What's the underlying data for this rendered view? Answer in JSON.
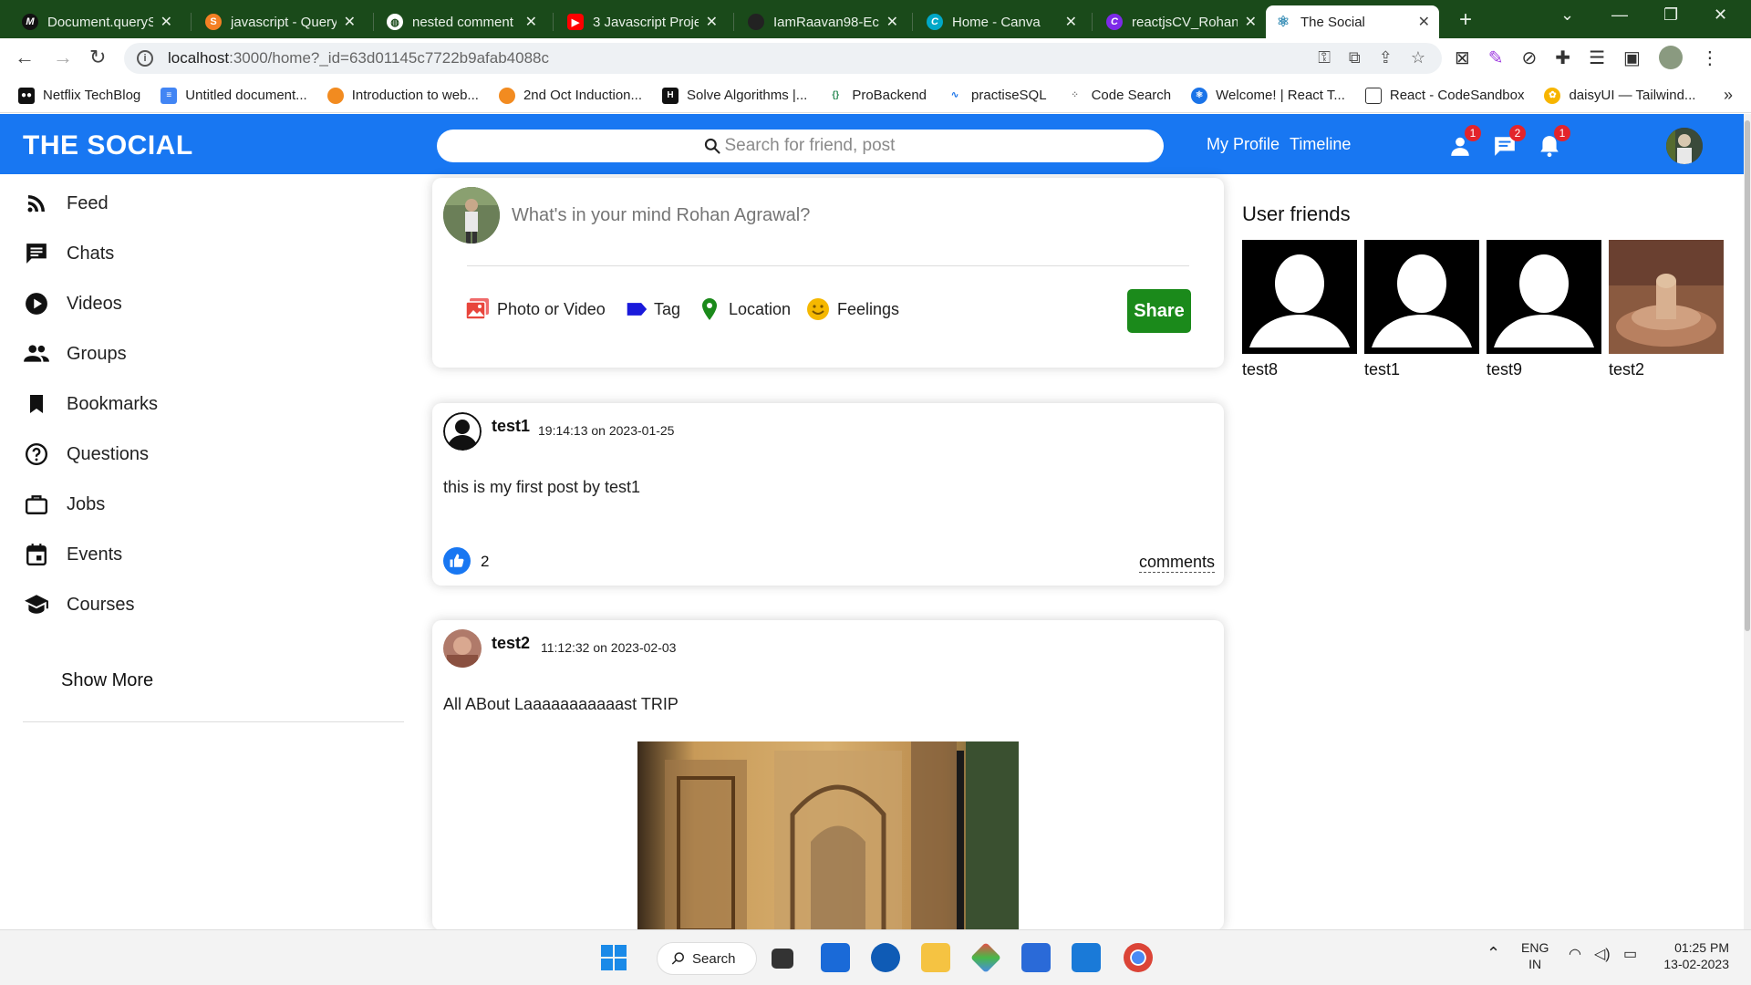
{
  "browser": {
    "tabs": [
      {
        "title": "Document.queryS",
        "icon": "m-icon",
        "color": "#ffffff"
      },
      {
        "title": "javascript - Query",
        "icon": "stackoverflow-icon",
        "color": "#f48024"
      },
      {
        "title": "nested comment",
        "icon": "globe-icon",
        "color": "#ffffff"
      },
      {
        "title": "3 Javascript Proje",
        "icon": "youtube-icon",
        "color": "#ff0000"
      },
      {
        "title": "IamRaavan98-Eco",
        "icon": "github-icon",
        "color": "#333333"
      },
      {
        "title": "Home - Canva",
        "icon": "canva-icon",
        "color": "#00c4cc"
      },
      {
        "title": "reactjsCV_Rohan",
        "icon": "canva-icon",
        "color": "#7d2ae8"
      },
      {
        "title": "The Social",
        "icon": "react-icon",
        "color": "#61dafb"
      }
    ],
    "new_tab": "+",
    "url_host": "localhost",
    "url_rest": ":3000/home?_id=63d01145c7722b9afab4088c",
    "bookmarks": [
      {
        "label": "Netflix TechBlog",
        "color": "#000000",
        "glyph": "M"
      },
      {
        "label": "Untitled document...",
        "color": "#4285f4",
        "glyph": "≡"
      },
      {
        "label": "Introduction to web...",
        "color": "#f28b20",
        "glyph": ""
      },
      {
        "label": "2nd Oct Induction...",
        "color": "#f28b20",
        "glyph": ""
      },
      {
        "label": "Solve Algorithms |...",
        "color": "#000000",
        "glyph": "H"
      },
      {
        "label": "ProBackend",
        "color": "#2e8b57",
        "glyph": "{}"
      },
      {
        "label": "practiseSQL",
        "color": "#1a73e8",
        "glyph": "~"
      },
      {
        "label": "Code Search",
        "color": "#777777",
        "glyph": "⁘"
      },
      {
        "label": "Welcome! | React T...",
        "color": "#1a73e8",
        "glyph": "⚛"
      },
      {
        "label": "React - CodeSandbox",
        "color": "#ffffff",
        "glyph": ""
      },
      {
        "label": "daisyUI — Tailwind...",
        "color": "#f7b500",
        "glyph": "✿"
      }
    ],
    "bookmarks_more": "»"
  },
  "app": {
    "logo": "THE SOCIAL",
    "search_placeholder": "Search for friend, post or video",
    "links": {
      "profile": "My Profile",
      "timeline": "Timeline"
    },
    "badges": {
      "friends": "1",
      "chat": "2",
      "notifications": "1"
    },
    "accent": "#1877f2"
  },
  "sidebar": {
    "items": [
      {
        "label": "Feed",
        "icon": "rss-icon"
      },
      {
        "label": "Chats",
        "icon": "chat-icon"
      },
      {
        "label": "Videos",
        "icon": "play-circle-icon"
      },
      {
        "label": "Groups",
        "icon": "group-icon"
      },
      {
        "label": "Bookmarks",
        "icon": "bookmark-icon"
      },
      {
        "label": "Questions",
        "icon": "help-circle-icon"
      },
      {
        "label": "Jobs",
        "icon": "briefcase-icon"
      },
      {
        "label": "Events",
        "icon": "calendar-icon"
      },
      {
        "label": "Courses",
        "icon": "school-icon"
      }
    ],
    "show_more": "Show More"
  },
  "share": {
    "placeholder": "What's in your mind Rohan Agrawal?",
    "options": {
      "photo": "Photo or Video",
      "tag": "Tag",
      "location": "Location",
      "feelings": "Feelings"
    },
    "button": "Share"
  },
  "posts": [
    {
      "user": "test1",
      "time": "19:14:13 on 2023-01-25",
      "text": "this is my first post by test1",
      "likes": "2",
      "comments": "comments"
    },
    {
      "user": "test2",
      "time": "11:12:32 on 2023-02-03",
      "text": "All ABout Laaaaaaaaaaast TRIP"
    }
  ],
  "friends": {
    "title": "User friends",
    "list": [
      "test8",
      "test1",
      "test9",
      "test2"
    ]
  },
  "taskbar": {
    "search": "Search",
    "lang1": "ENG",
    "lang2": "IN",
    "time": "01:25 PM",
    "date": "13-02-2023"
  }
}
